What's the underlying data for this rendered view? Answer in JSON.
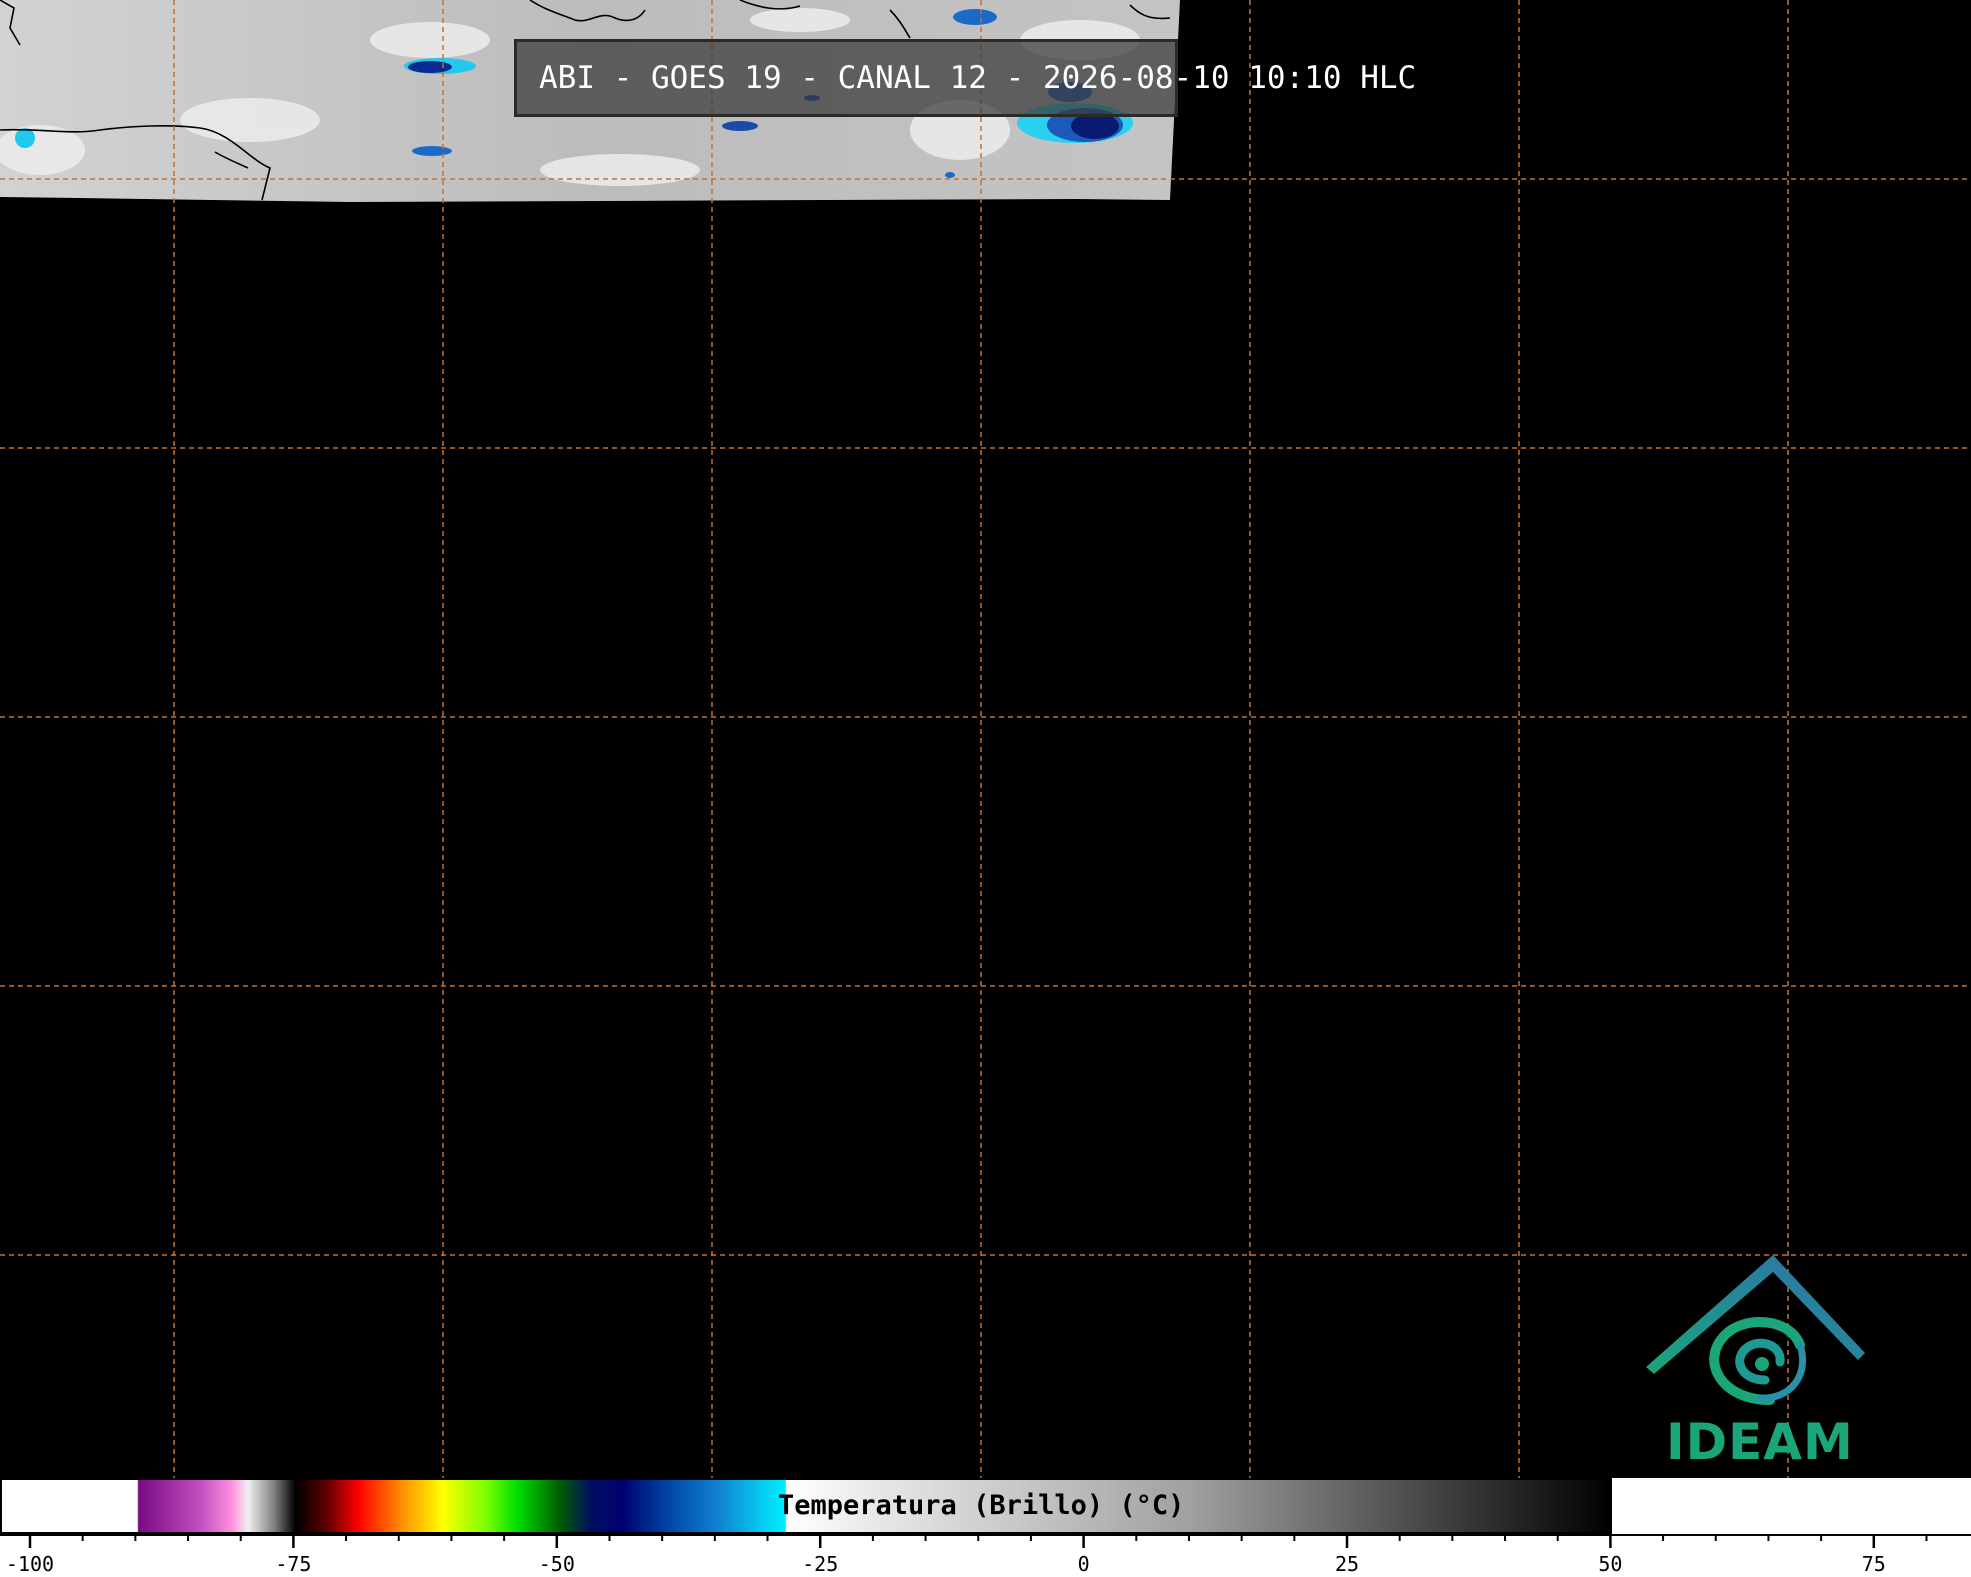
{
  "title": "ABI - GOES 19 - CANAL 12 - 2026-08-10 10:10 HLC",
  "logo": {
    "text": "IDEAM"
  },
  "colorbar": {
    "label": "Temperatura (Brillo) (°C)",
    "min": -106,
    "max": 87,
    "tick_labels": [
      "-100",
      "-75",
      "-50",
      "-25",
      "0",
      "25",
      "50",
      "75"
    ],
    "tick_values": [
      -100,
      -75,
      -50,
      -25,
      0,
      25,
      50,
      75
    ]
  },
  "colors": {
    "grid": "#c8702c",
    "background": "#000000",
    "logo_green": "#1aa57a",
    "logo_blue": "#2f6fb0"
  }
}
